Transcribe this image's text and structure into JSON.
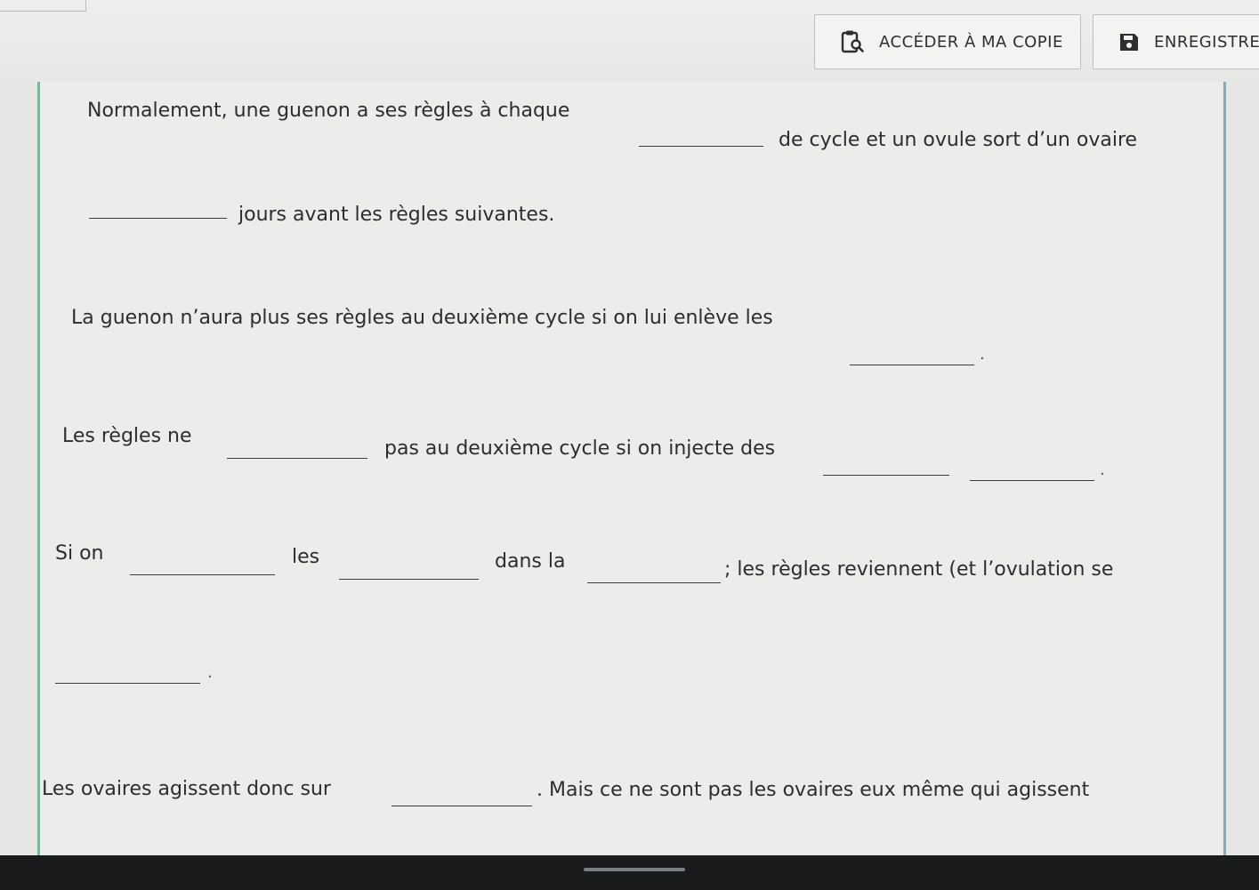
{
  "toolbar": {
    "access_copy_label": "ACCÉDER À MA COPIE",
    "save_label": "ENREGISTRER"
  },
  "exercise": {
    "s1_a": "Normalement, une guenon a ses règles à chaque",
    "s1_b": "de cycle et un ovule sort d’un ovaire",
    "s1_c": "jours avant les règles suivantes.",
    "s2_a": "La guenon n’aura plus ses règles au deuxième cycle si on lui enlève les",
    "s3_a": "Les règles ne",
    "s3_b": "pas au deuxième cycle si on injecte des",
    "s4_a": "Si on",
    "s4_b": "les",
    "s4_c": "dans la",
    "s4_d": "; les règles reviennent (et l’ovulation se",
    "s5_a": "Les ovaires agissent donc sur",
    "s5_b": ". Mais ce ne sont pas les ovaires eux même qui agissent",
    "period": "."
  },
  "icons": {
    "access_copy": "clipboard-search-icon",
    "save": "floppy-disk-icon"
  },
  "colors": {
    "paper_left_border": "#7fb49b",
    "background": "#e6e7e5"
  }
}
